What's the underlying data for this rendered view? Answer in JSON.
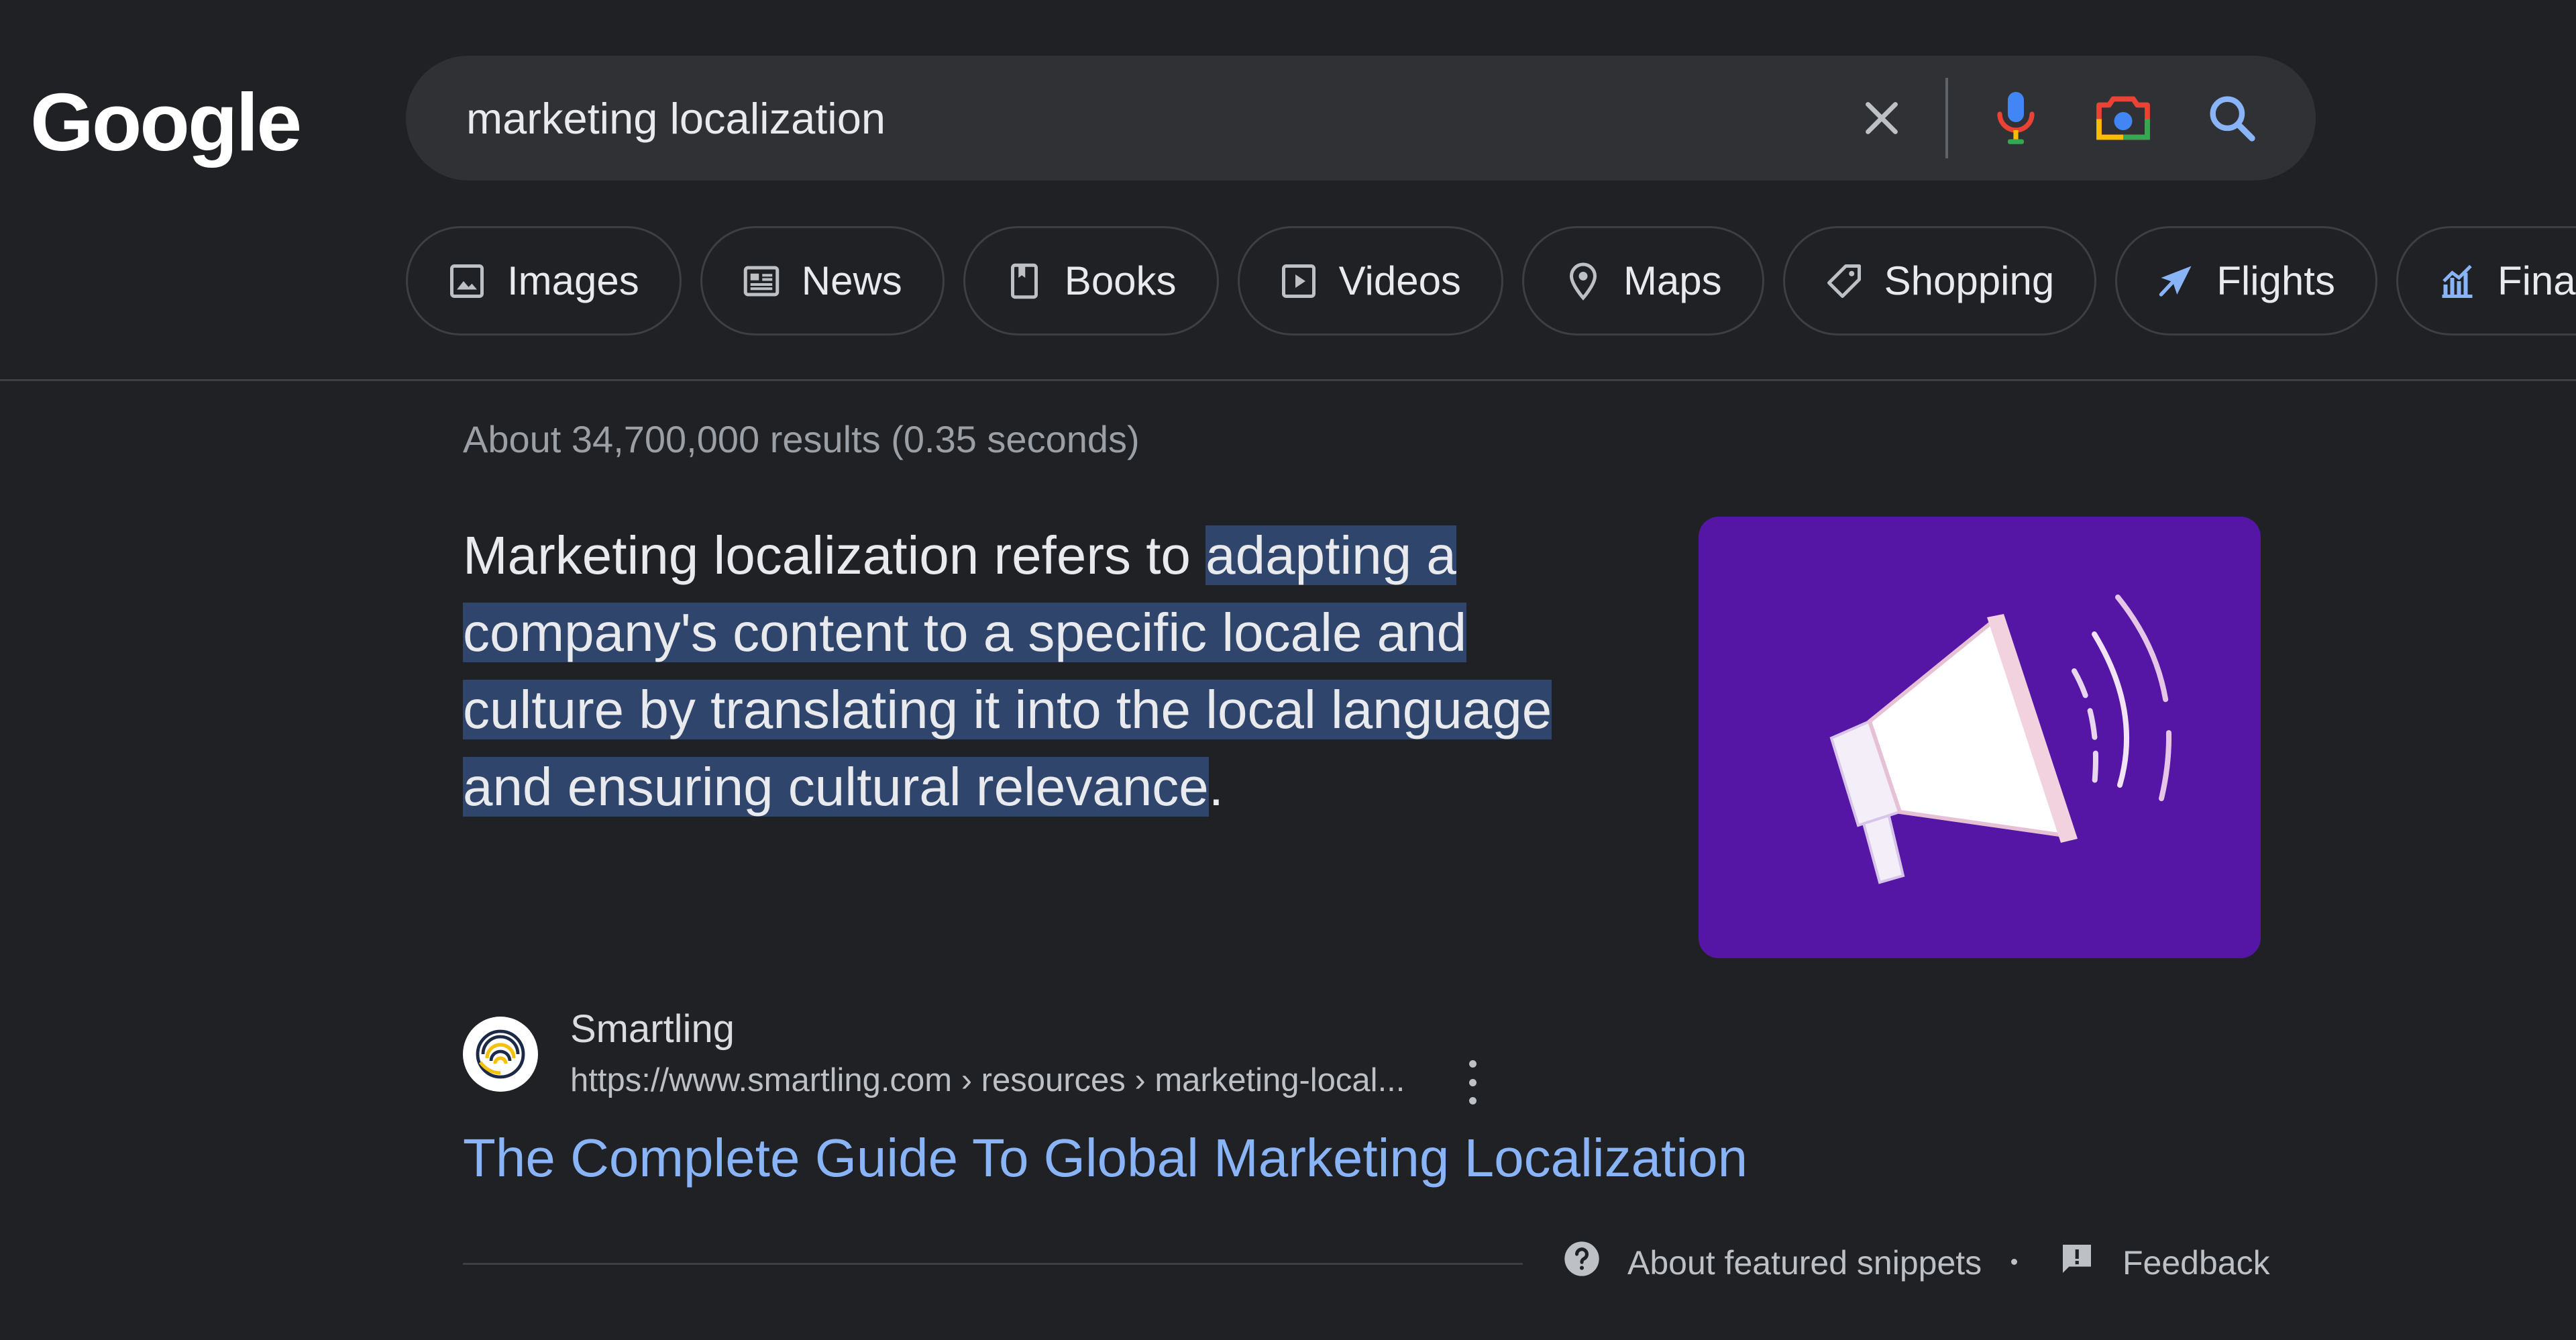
{
  "header": {
    "logo_text": "Google",
    "search": {
      "query": "marketing localization",
      "clear_icon": "close-icon",
      "voice_icon": "microphone-icon",
      "lens_icon": "camera-lens-icon",
      "search_icon": "search-icon"
    }
  },
  "chips": [
    {
      "label": "Images",
      "icon": "image-icon"
    },
    {
      "label": "News",
      "icon": "newspaper-icon"
    },
    {
      "label": "Books",
      "icon": "book-icon"
    },
    {
      "label": "Videos",
      "icon": "play-icon"
    },
    {
      "label": "Maps",
      "icon": "map-pin-icon"
    },
    {
      "label": "Shopping",
      "icon": "tag-icon"
    },
    {
      "label": "Flights",
      "icon": "airplane-icon"
    },
    {
      "label": "Finance",
      "icon": "finance-chart-icon"
    }
  ],
  "results": {
    "stats": "About 34,700,000 results (0.35 seconds)",
    "featured_snippet": {
      "lead": "Marketing localization refers to ",
      "highlighted": "adapting a company's content to a specific locale and culture by translating it into the local language and ensuring cultural relevance",
      "trail": ".",
      "image_icon": "megaphone-icon"
    },
    "source": {
      "site_name": "Smartling",
      "url": "https://www.smartling.com › resources › marketing-local...",
      "title": "The Complete Guide To Global Marketing Localization"
    },
    "footer": {
      "about_label": "About featured snippets",
      "feedback_label": "Feedback"
    }
  },
  "colors": {
    "background": "#202124",
    "search_bar": "#303134",
    "link": "#8ab4f8",
    "highlight": "#30456b",
    "snippet_image_bg": "#5616a5"
  }
}
